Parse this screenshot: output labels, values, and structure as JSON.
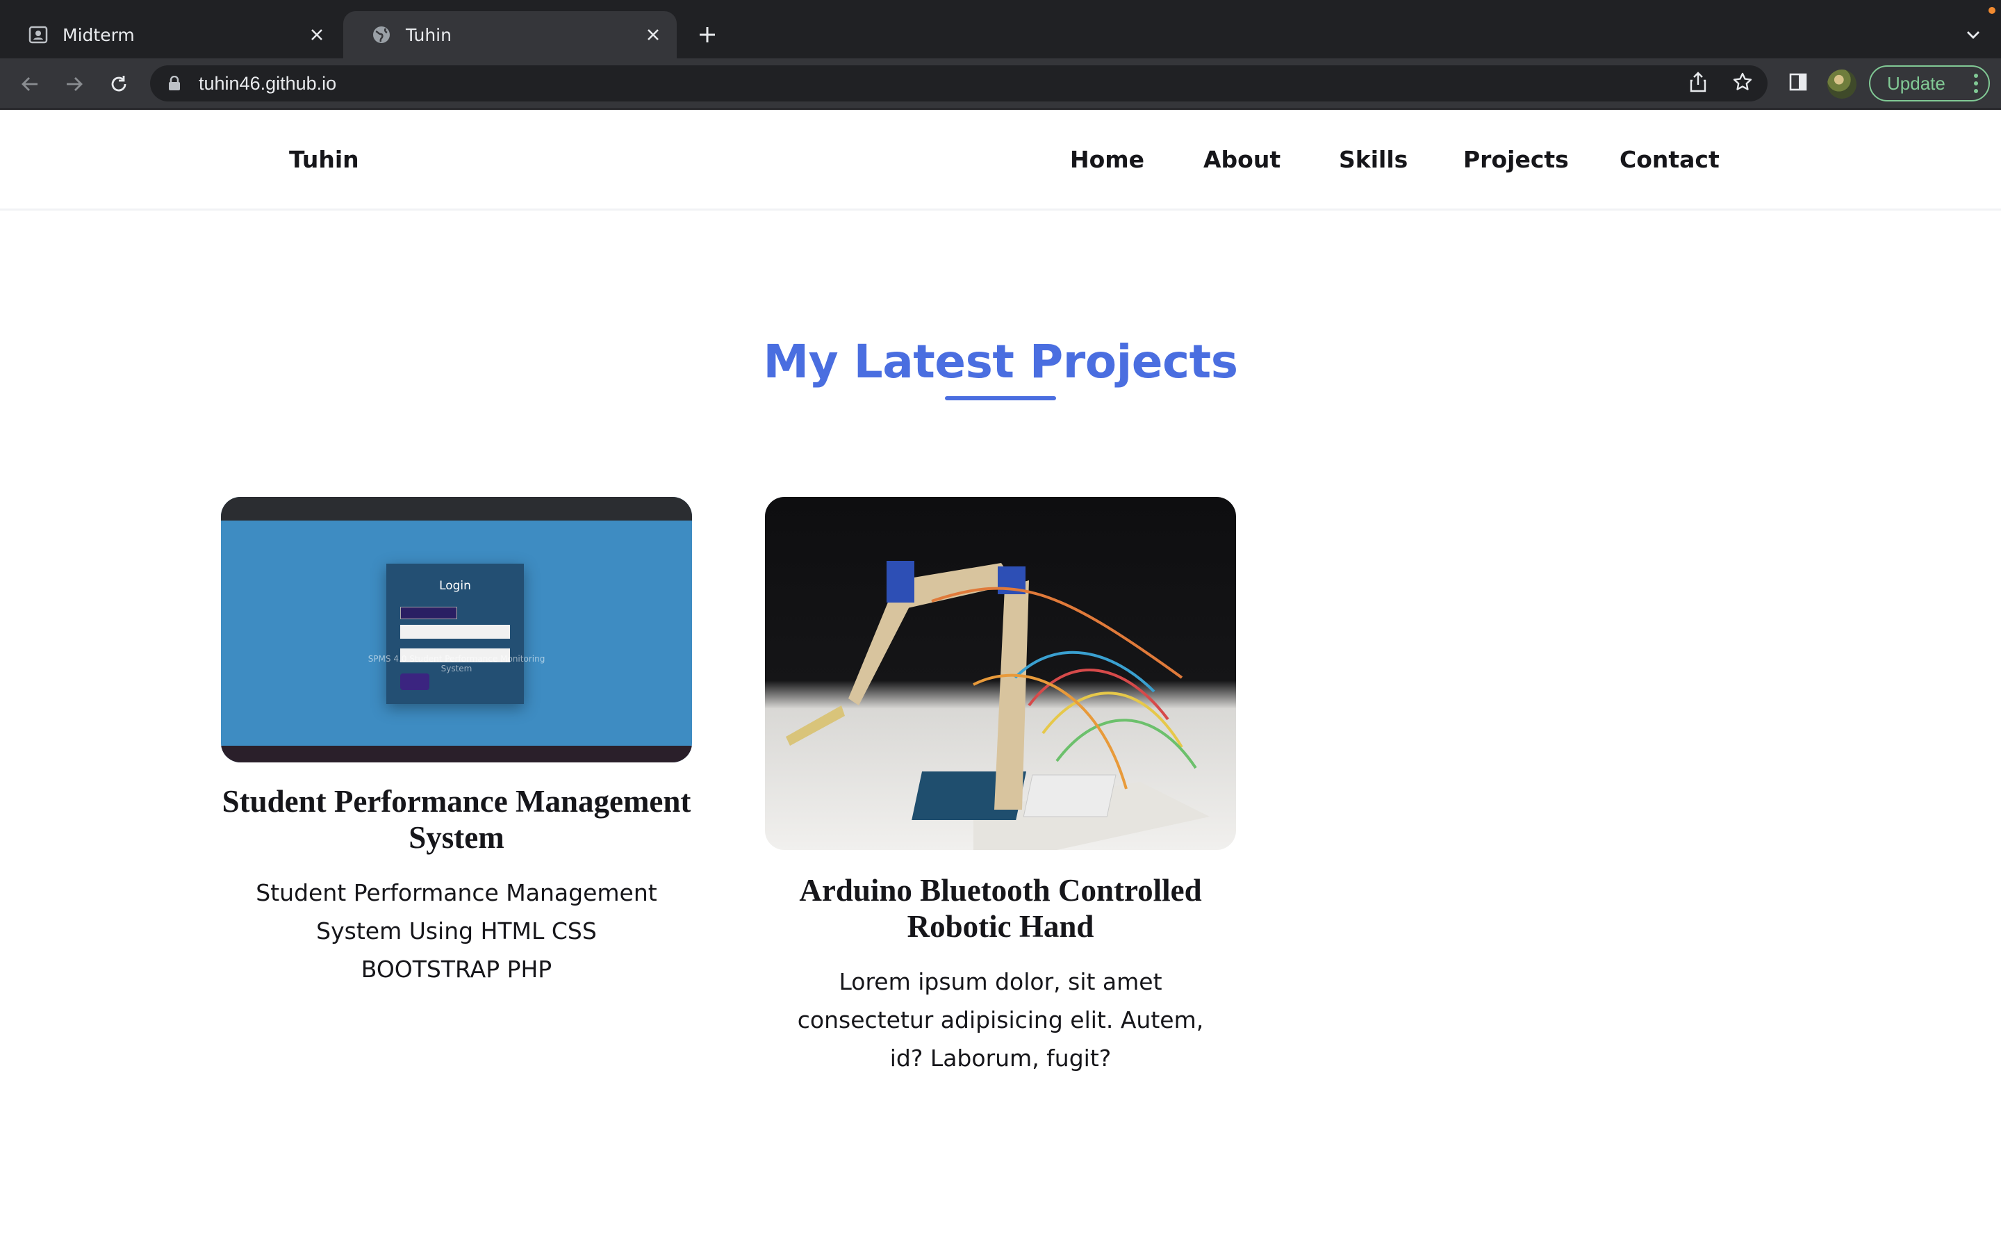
{
  "browser": {
    "tabs": [
      {
        "title": "Midterm",
        "active": false
      },
      {
        "title": "Tuhin",
        "active": true
      }
    ],
    "url": "tuhin46.github.io",
    "update_label": "Update",
    "colors": {
      "frame": "#202124",
      "toolbar": "#35363a",
      "update": "#81c995"
    }
  },
  "site": {
    "brand": "Tuhin",
    "nav": [
      "Home",
      "About",
      "Skills",
      "Projects",
      "Contact"
    ],
    "section_title": "My Latest Projects",
    "accent": "#4a6ee0",
    "projects": [
      {
        "title": "Student Performance Management System",
        "description": "Student Performance Management System Using HTML CSS BOOTSTRAP PHP",
        "image": {
          "login_title": "Login",
          "caption": "SPMS 4.0 Student Performance Monitoring System"
        }
      },
      {
        "title": "Arduino Bluetooth Controlled Robotic Hand",
        "description": "Lorem ipsum dolor, sit amet consectetur adipisicing elit. Autem, id? Laborum, fugit?",
        "image": {
          "subject": "robotic arm with Arduino breadboard"
        }
      }
    ]
  }
}
